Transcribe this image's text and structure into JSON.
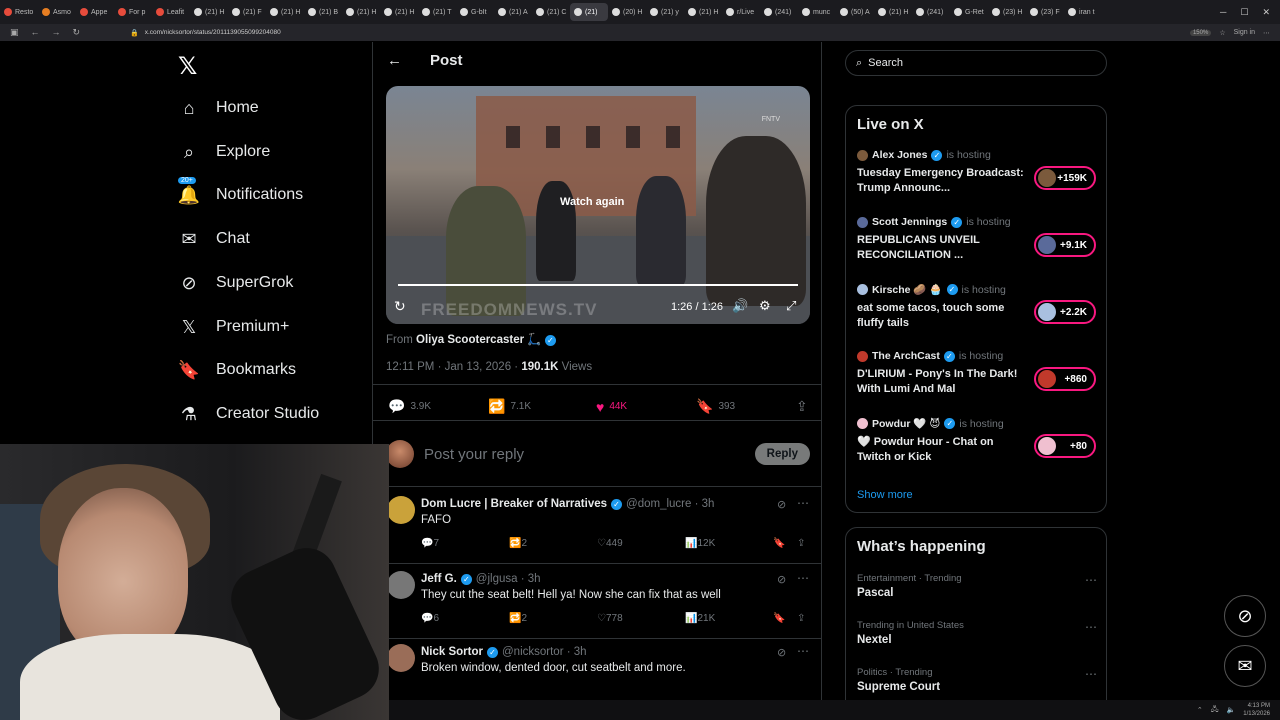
{
  "browser": {
    "tabs": [
      "Resto",
      "Asmo",
      "Appe",
      "For p",
      "Leafit",
      "(21) H",
      "(21) F",
      "(21) H",
      "(21) B",
      "(21) H",
      "(21) H",
      "(21) T",
      "G-bIt",
      "(21) A",
      "(21) C",
      "(21)",
      "(20) H",
      "(21) y",
      "(21) H",
      "r/Live",
      "(241)",
      "munc",
      "(50) A",
      "(21) H",
      "(241)",
      "G-Ret",
      "(23) H",
      "(23) F",
      "iran t"
    ],
    "active_tab_index": 15,
    "url": "x.com/nicksortor/status/2011139055099204080",
    "zoom": "150%",
    "sign_in": "Sign in"
  },
  "nav": {
    "items": [
      {
        "label": "Home",
        "icon": "home-icon"
      },
      {
        "label": "Explore",
        "icon": "search-icon"
      },
      {
        "label": "Notifications",
        "icon": "bell-icon",
        "badge": "20+"
      },
      {
        "label": "Chat",
        "icon": "mail-icon"
      },
      {
        "label": "SuperGrok",
        "icon": "grok-icon"
      },
      {
        "label": "Premium+",
        "icon": "x-icon"
      },
      {
        "label": "Bookmarks",
        "icon": "bookmark-icon"
      },
      {
        "label": "Creator Studio",
        "icon": "flask-icon"
      }
    ]
  },
  "post": {
    "header": "Post",
    "video": {
      "overlay": "Watch again",
      "watermark": "FREEDOMNEWS.TV",
      "corner_mark": "FNTV",
      "time": "1:26 / 1:26",
      "progress": 1.0
    },
    "from_prefix": "From",
    "from_name": "Oliya Scootercaster 🛴",
    "timestamp": "12:11 PM · Jan 13, 2026 ·",
    "views_count": "190.1K",
    "views_label": "Views",
    "stats": {
      "replies": "3.9K",
      "reposts": "7.1K",
      "likes": "44K",
      "bookmarks": "393"
    },
    "reply_placeholder": "Post your reply",
    "reply_button": "Reply"
  },
  "replies": [
    {
      "name": "Dom Lucre | Breaker of Narratives",
      "handle": "@dom_lucre · 3h",
      "text": "FAFO",
      "replies": "7",
      "reposts": "2",
      "likes": "449",
      "views": "12K"
    },
    {
      "name": "Jeff G.",
      "handle": "@jlgusa · 3h",
      "text": "They cut the seat belt! Hell ya! Now she can fix that as well",
      "replies": "6",
      "reposts": "2",
      "likes": "778",
      "views": "21K"
    },
    {
      "name": "Nick Sortor",
      "handle": "@nicksortor · 3h",
      "text": "Broken window, dented door, cut seatbelt and more.",
      "replies": "",
      "reposts": "",
      "likes": "",
      "views": ""
    }
  ],
  "right": {
    "search_placeholder": "Search",
    "live_title": "Live on X",
    "is_hosting": "is hosting",
    "live": [
      {
        "host": "Alex Jones",
        "title": "Tuesday Emergency Broadcast: Trump Announc...",
        "count": "+159K"
      },
      {
        "host": "Scott Jennings",
        "title": "REPUBLICANS UNVEIL RECONCILIATION ...",
        "count": "+9.1K"
      },
      {
        "host": "Kirsche 🥔 🧁",
        "title": "eat some tacos, touch some fluffy tails",
        "count": "+2.2K"
      },
      {
        "host": "The ArchCast",
        "title": "D'LIRIUM - Pony's In The Dark! With Lumi And Mal",
        "count": "+860"
      },
      {
        "host": "Powdur 🤍 😈",
        "title": "🤍 Powdur Hour - Chat on Twitch or Kick",
        "count": "+80"
      }
    ],
    "show_more": "Show more",
    "happening_title": "What’s happening",
    "trends": [
      {
        "context": "Entertainment · Trending",
        "topic": "Pascal"
      },
      {
        "context": "Trending in United States",
        "topic": "Nextel"
      },
      {
        "context": "Politics · Trending",
        "topic": "Supreme Court"
      }
    ]
  },
  "taskbar": {
    "time": "4:13 PM",
    "date": "1/13/2026"
  }
}
